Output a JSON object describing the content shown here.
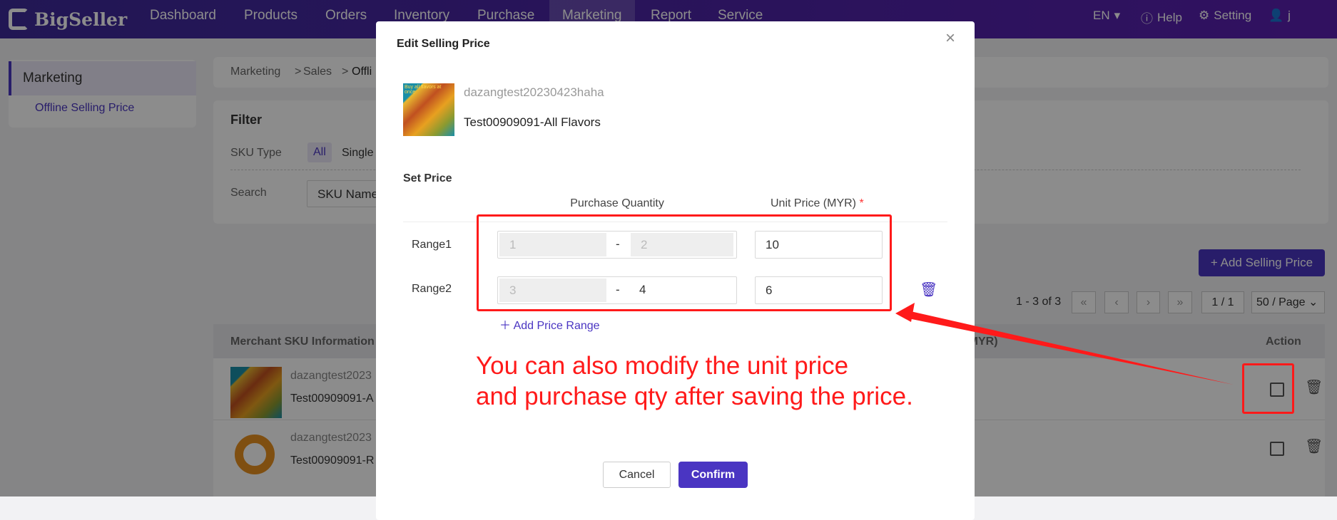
{
  "nav": {
    "brand": "BigSeller",
    "items": [
      "Dashboard",
      "Products",
      "Orders",
      "Inventory",
      "Purchase",
      "Marketing",
      "Report",
      "Service"
    ],
    "active": "Marketing",
    "lang": "EN",
    "help": "Help",
    "setting": "Setting",
    "user": "j"
  },
  "sidebar": {
    "section": "Marketing",
    "item": "Offline Selling Price"
  },
  "breadcrumb": [
    "Marketing",
    ">",
    "Sales",
    ">",
    "Offli"
  ],
  "filter": {
    "title": "Filter",
    "sku_type_label": "SKU Type",
    "sku_type_options": [
      "All",
      "Single"
    ],
    "search_label": "Search",
    "search_field": "SKU Name"
  },
  "toolbar": {
    "add_button": "+ Add Selling Price",
    "range_text": "1 - 3 of 3",
    "page": "1 / 1",
    "per_page": "50 / Page"
  },
  "table": {
    "headers": {
      "sku": "Merchant SKU Information",
      "price": "e (MYR)",
      "action": "Action"
    },
    "rows": [
      {
        "store": "dazangtest2023",
        "sku": "Test00909091-A"
      },
      {
        "store": "dazangtest2023",
        "sku": "Test00909091-R"
      }
    ]
  },
  "modal": {
    "title": "Edit Selling Price",
    "store": "dazangtest20230423haha",
    "sku": "Test00909091-All Flavors",
    "image_caption": "Buy all flavors at once",
    "set_price": "Set Price",
    "col_qty": "Purchase Quantity",
    "col_price": "Unit Price (MYR)",
    "required": "*",
    "ranges": [
      {
        "label": "Range1",
        "from": "1",
        "to": "2",
        "price": "10"
      },
      {
        "label": "Range2",
        "from": "3",
        "to": "4",
        "price": "6"
      }
    ],
    "dash": "-",
    "add_range": "Add Price Range",
    "cancel": "Cancel",
    "confirm": "Confirm"
  },
  "annotation": {
    "line1": "You can also modify the unit price",
    "line2": "and purchase qty after saving the price.",
    "color": "#ff1a1a"
  }
}
